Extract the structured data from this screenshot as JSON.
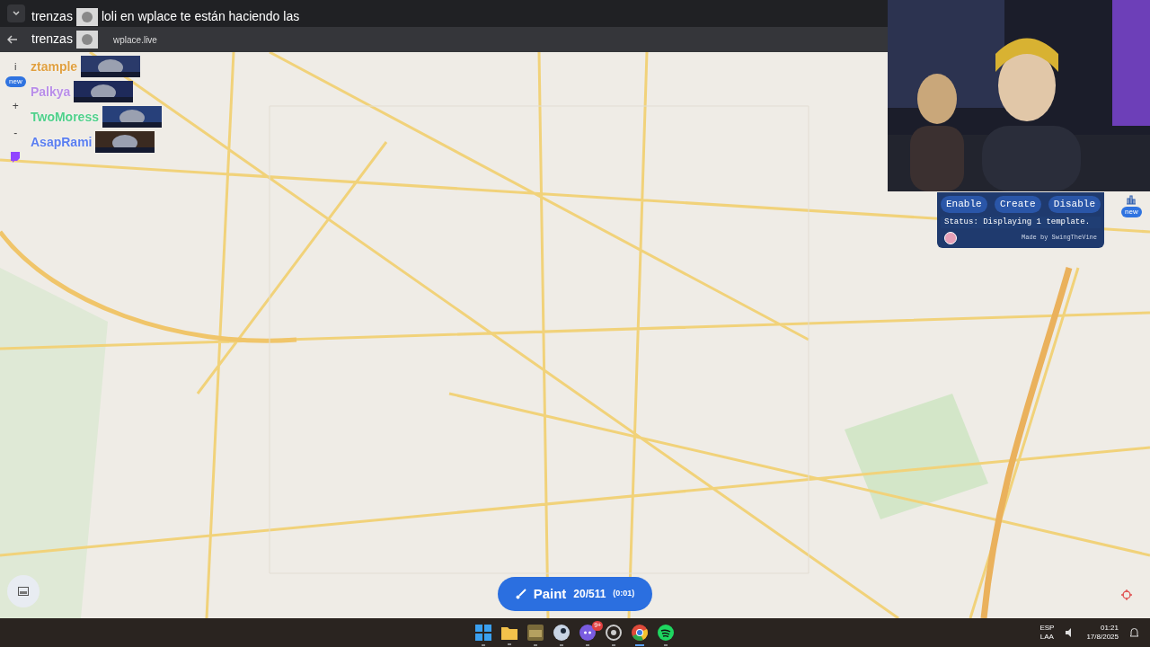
{
  "caption": {
    "lines": [
      {
        "text": "trenzas",
        "after": "loli en wplace te están haciendo las"
      },
      {
        "text": "trenzas"
      }
    ]
  },
  "browser": {
    "address": "wplace.live"
  },
  "chat": [
    {
      "name": "ztample",
      "color": "#e0a040"
    },
    {
      "name": "Palkya",
      "color": "#b98ee8"
    },
    {
      "name": "TwoMoress",
      "color": "#4fd08a"
    },
    {
      "name": "AsapRami",
      "color": "#5a7ef0"
    }
  ],
  "map_controls": {
    "info": "i",
    "badge": "new",
    "zoom_in": "+",
    "zoom_out": "-"
  },
  "template_panel": {
    "buttons": [
      "Enable",
      "Create",
      "Disable"
    ],
    "status": "Status: Displaying 1 template.",
    "credit": "Made by SwingTheVine"
  },
  "right_badge": "new",
  "paint_button": {
    "label": "Paint",
    "count": "20/511",
    "timer": "(0:01)"
  },
  "taskbar": {
    "apps": [
      {
        "kind": "windows",
        "active": false
      },
      {
        "kind": "folder",
        "active": false
      },
      {
        "kind": "game",
        "active": false
      },
      {
        "kind": "steam",
        "active": false
      },
      {
        "kind": "discord",
        "active": false,
        "badge": "9+"
      },
      {
        "kind": "obs",
        "active": false
      },
      {
        "kind": "chrome",
        "active": true
      },
      {
        "kind": "spotify",
        "active": false
      }
    ],
    "lang": [
      "ESP",
      "LAA"
    ],
    "time": "01:21",
    "date": "17/8/2025"
  }
}
